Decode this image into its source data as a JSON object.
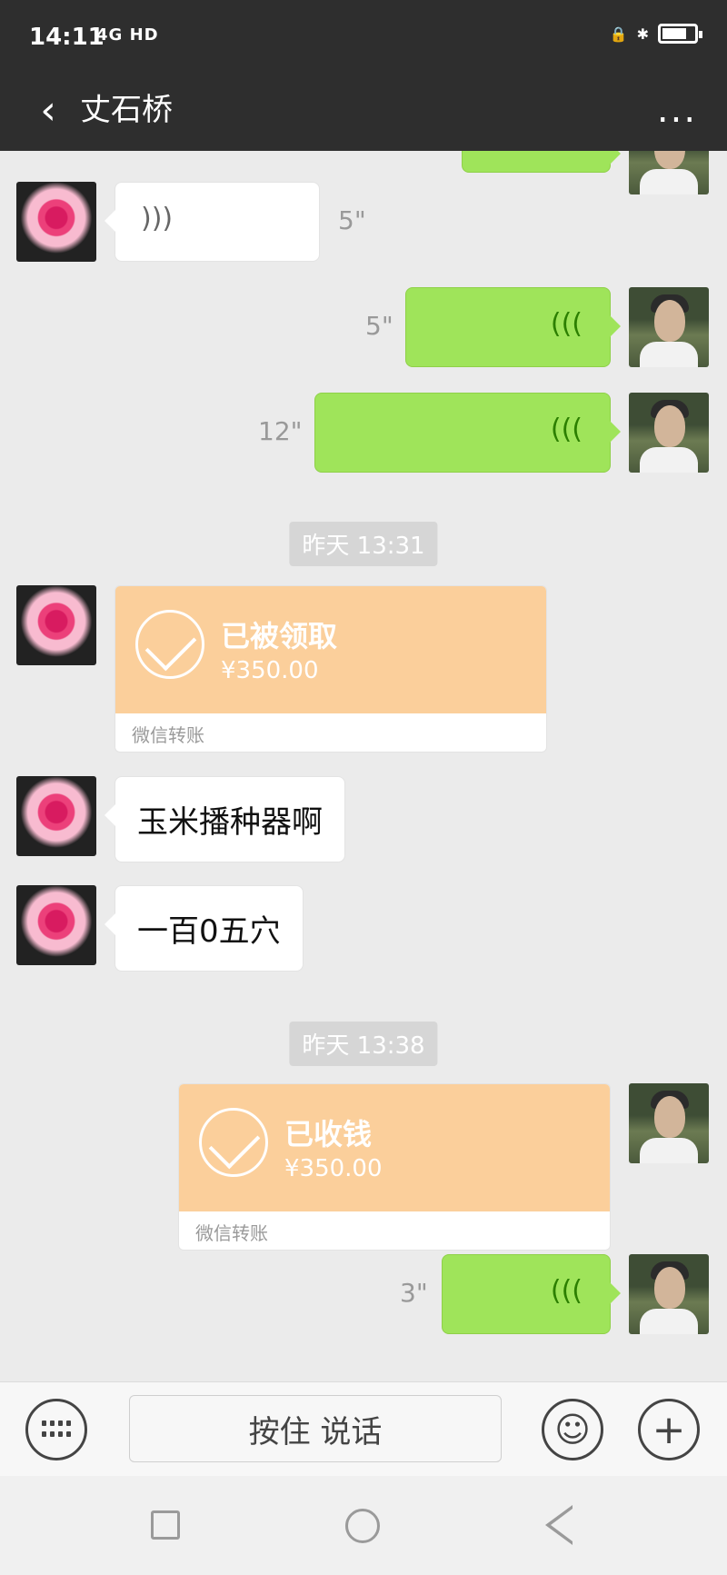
{
  "status": {
    "time": "14:11",
    "network": "4G HD",
    "battery_level": 0.75
  },
  "header": {
    "contact_name": "丈石桥",
    "more_label": "..."
  },
  "messages": [
    {
      "type": "voice",
      "side": "left",
      "duration": "5\""
    },
    {
      "type": "voice",
      "side": "right",
      "duration": "5\""
    },
    {
      "type": "voice",
      "side": "right",
      "duration": "12\""
    },
    {
      "type": "timestamp",
      "text": "昨天 13:31"
    },
    {
      "type": "transfer",
      "side": "left",
      "status": "已被领取",
      "amount": "¥350.00",
      "service": "微信转账"
    },
    {
      "type": "text",
      "side": "left",
      "text": "玉米播种器啊"
    },
    {
      "type": "text",
      "side": "left",
      "text": "一百0五穴"
    },
    {
      "type": "timestamp",
      "text": "昨天 13:38"
    },
    {
      "type": "transfer",
      "side": "right",
      "status": "已收钱",
      "amount": "¥350.00",
      "service": "微信转账"
    },
    {
      "type": "voice",
      "side": "right",
      "duration": "3\""
    }
  ],
  "inputbar": {
    "hold_to_talk_label": "按住 说话",
    "keyboard_icon": "keyboard-icon",
    "emoji_icon": "emoji-icon",
    "plus_icon": "plus-icon"
  },
  "navbar": {
    "square_icon": "recent-apps-icon",
    "circle_icon": "home-icon",
    "triangle_icon": "back-icon"
  }
}
